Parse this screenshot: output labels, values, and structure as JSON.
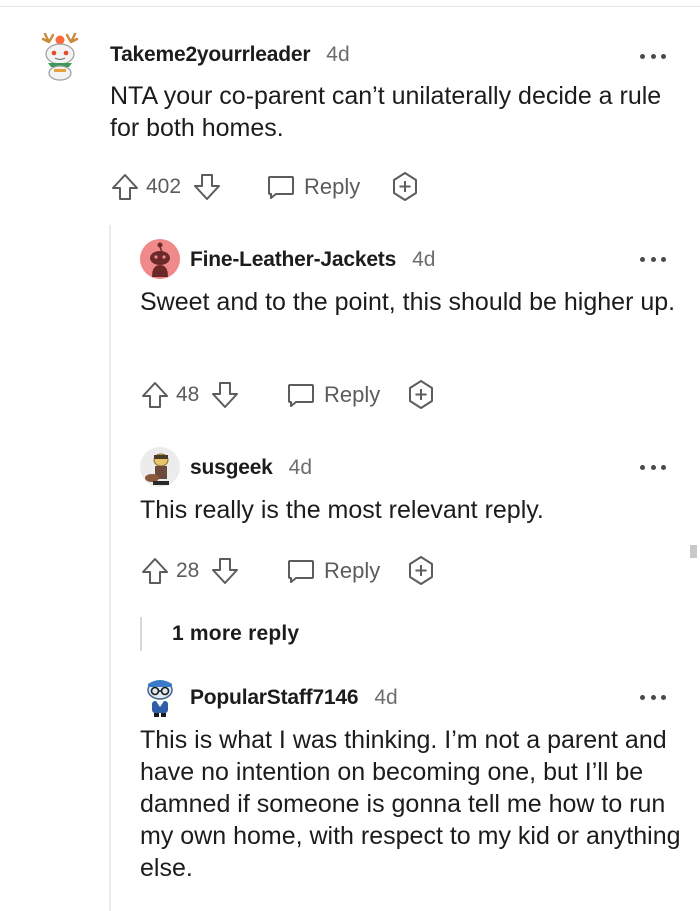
{
  "comments": [
    {
      "username": "Takeme2yourrleader",
      "time": "4d",
      "text": "NTA your co-parent can’t unilaterally decide a rule for both homes.",
      "votes": "402",
      "reply_label": "Reply",
      "avatar_icon": "snoo-reindeer-avatar-icon"
    },
    {
      "username": "Fine-Leather-Jackets",
      "time": "4d",
      "text": "Sweet and to the point, this should be higher up.",
      "votes": "48",
      "reply_label": "Reply",
      "avatar_icon": "default-snoo-avatar-icon"
    },
    {
      "username": "susgeek",
      "time": "4d",
      "text": "This really is the most relevant reply.",
      "votes": "28",
      "reply_label": "Reply",
      "avatar_icon": "snoo-figure-avatar-icon"
    },
    {
      "username": "PopularStaff7146",
      "time": "4d",
      "text": "This is what I was thinking. I’m not a parent and have no intention on becoming one, but I’ll be damned if someone is gonna tell me how to run my own home, with respect to my kid or anything else.",
      "avatar_icon": "snoo-glasses-avatar-icon"
    }
  ],
  "more_replies_label": "1 more reply",
  "colors": {
    "text": "#1c1c1c",
    "muted": "#5c5c5c",
    "default_avatar_bg": "#f08a8a",
    "reindeer_accent": "#e8a040"
  }
}
